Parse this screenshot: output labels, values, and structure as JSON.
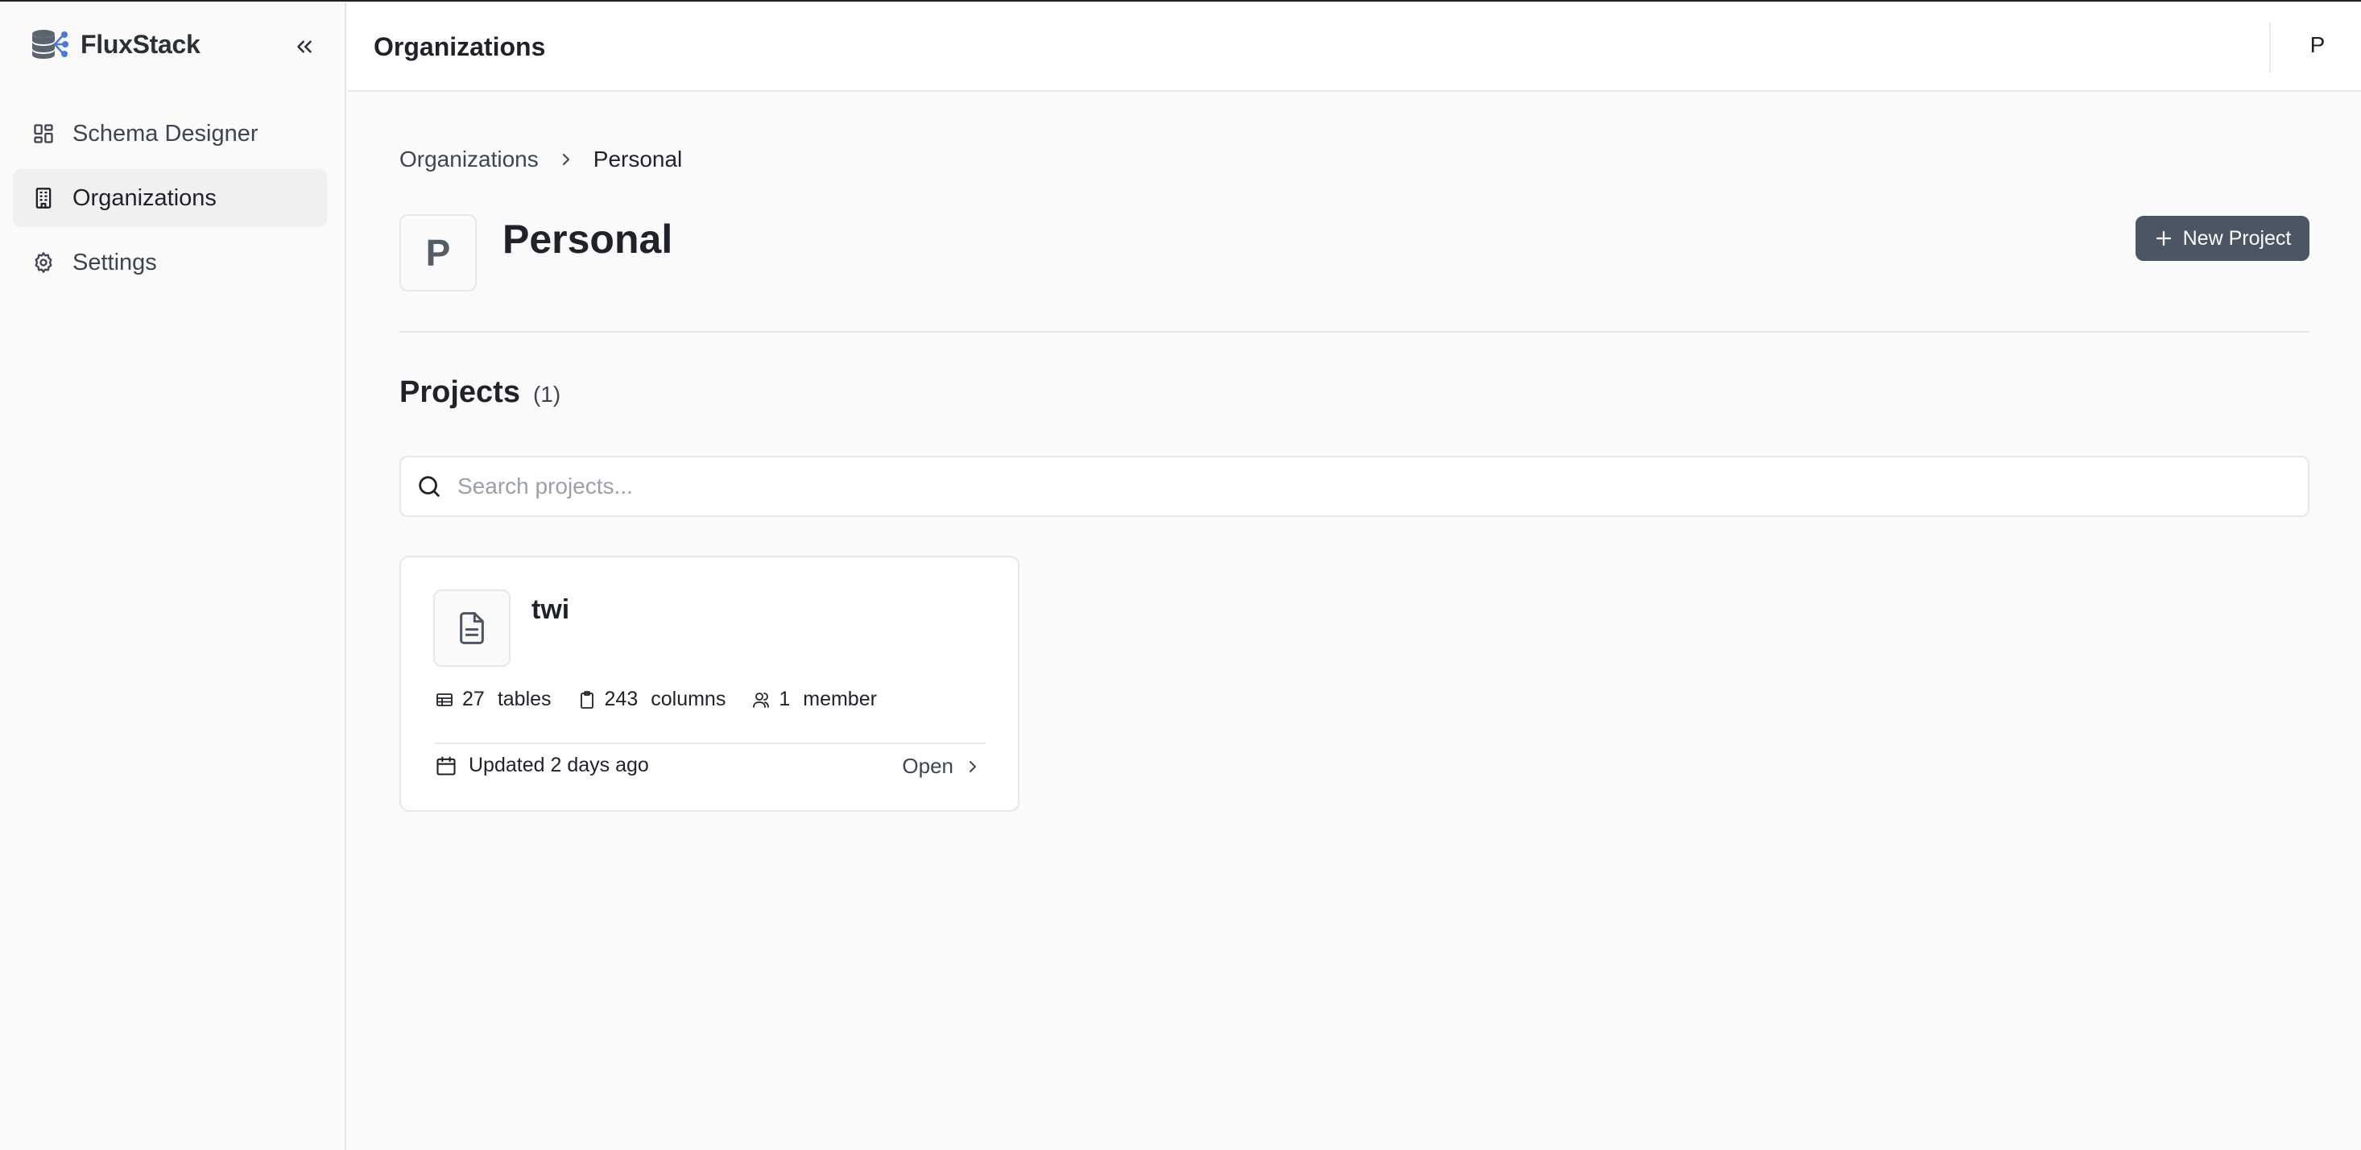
{
  "brand": {
    "name": "FluxStack",
    "accent": "#4a7bd8"
  },
  "sidebar": {
    "items": [
      {
        "label": "Schema Designer",
        "icon": "layout-grid-icon",
        "active": false
      },
      {
        "label": "Organizations",
        "icon": "building-icon",
        "active": true
      },
      {
        "label": "Settings",
        "icon": "gear-icon",
        "active": false
      }
    ]
  },
  "header": {
    "title": "Organizations",
    "user_initial": "P"
  },
  "breadcrumb": {
    "parent": "Organizations",
    "current": "Personal"
  },
  "org": {
    "initial": "P",
    "name": "Personal"
  },
  "actions": {
    "new_project_label": "New Project"
  },
  "projects": {
    "title": "Projects",
    "count_label": "(1)",
    "search_placeholder": "Search projects...",
    "items": [
      {
        "name": "twi",
        "tables_count": "27",
        "tables_label": "tables",
        "columns_count": "243",
        "columns_label": "columns",
        "members_count": "1",
        "members_label": "member",
        "updated": "Updated 2 days ago",
        "open_label": "Open"
      }
    ]
  },
  "colors": {
    "primary_button": "#4b5563",
    "active_nav_bg": "#f0f0f1",
    "border": "#e5e7eb",
    "background": "#fafafa"
  }
}
